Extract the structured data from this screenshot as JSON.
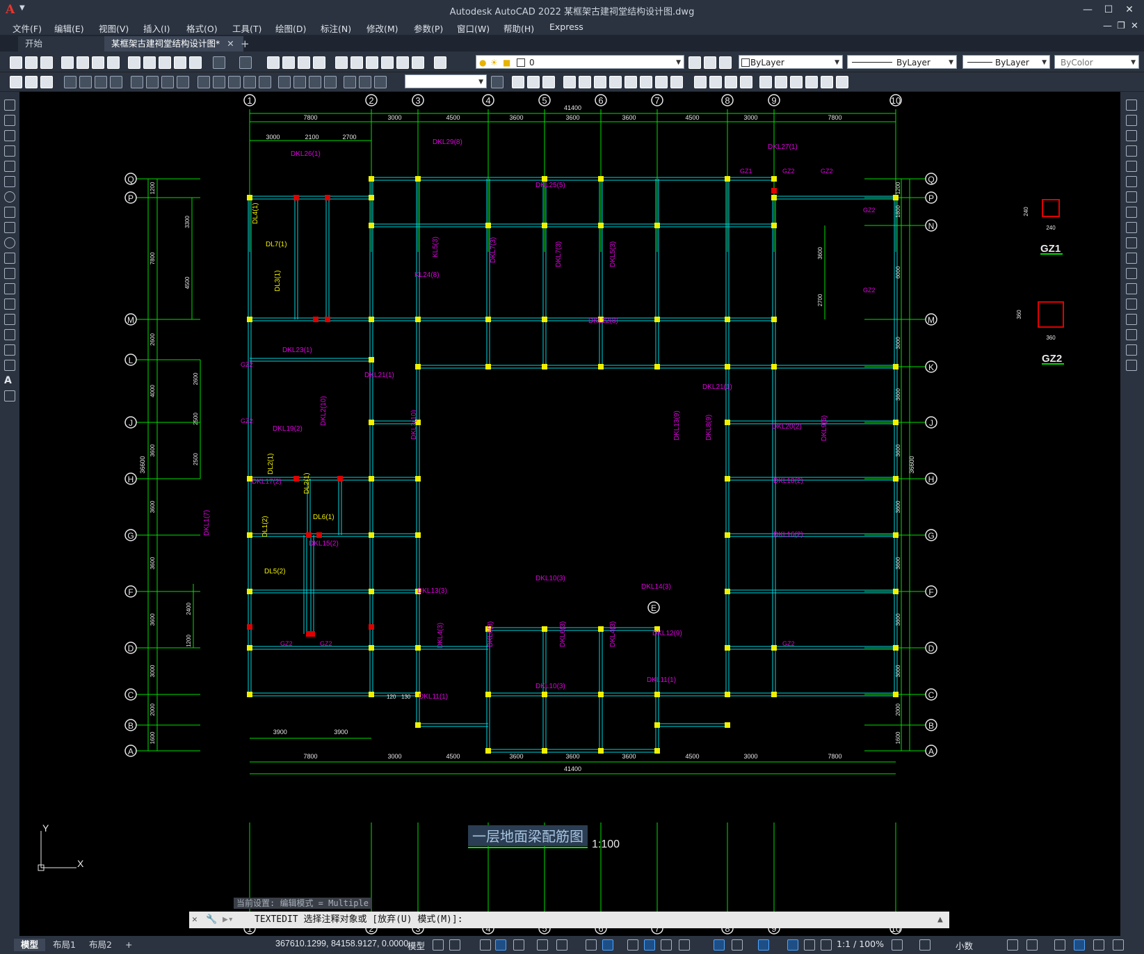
{
  "app": {
    "title": "Autodesk AutoCAD 2022    某框架古建祠堂结构设计图.dwg"
  },
  "menu": [
    "文件(F)",
    "编辑(E)",
    "视图(V)",
    "插入(I)",
    "格式(O)",
    "工具(T)",
    "绘图(D)",
    "标注(N)",
    "修改(M)",
    "参数(P)",
    "窗口(W)",
    "帮助(H)",
    "Express"
  ],
  "tabs": {
    "start": "开始",
    "document": "某框架古建祠堂结构设计图*"
  },
  "toolbar": {
    "layer_value": "0",
    "color_value": "ByLayer",
    "linetype_value": "ByLayer",
    "lineweight_value": "ByLayer",
    "plotstyle_value": "ByColor",
    "textstyle_value": ""
  },
  "drawing": {
    "axes_x": [
      "1",
      "2",
      "3",
      "4",
      "5",
      "6",
      "7",
      "8",
      "9",
      "10"
    ],
    "axes_y": [
      "Q",
      "P",
      "N",
      "M",
      "L",
      "K",
      "J",
      "H",
      "G",
      "F",
      "E",
      "D",
      "C",
      "B",
      "A"
    ],
    "dims_top_total": "41400",
    "dims_top": [
      "7800",
      "3000",
      "4500",
      "3600",
      "3600",
      "3600",
      "4500",
      "3000",
      "7800"
    ],
    "dims_top_sub": [
      "3000",
      "2100",
      "2700"
    ],
    "dims_bottom": [
      "7800",
      "3000",
      "4500",
      "3600",
      "3600",
      "3600",
      "4500",
      "3000",
      "7800"
    ],
    "dims_bottom_sub": [
      "3900",
      "3900"
    ],
    "dims_bottom_total": "41400",
    "dims_left_total": "36600",
    "dims_left": [
      "1200",
      "7800",
      "2600",
      "4000",
      "3600",
      "3600",
      "3600",
      "3600",
      "3000",
      "2000",
      "1600"
    ],
    "dims_left_inner": [
      "3300",
      "4500",
      "2600",
      "2500",
      "2500",
      "2400",
      "1200"
    ],
    "dims_right_total": "36600",
    "dims_right": [
      "1200",
      "1800",
      "6000",
      "3000",
      "3600",
      "3600",
      "3600",
      "3600",
      "3600",
      "3000",
      "2000",
      "1600"
    ],
    "dims_right_inner": [
      "3600",
      "2700"
    ],
    "gz_labels": [
      "GZ2",
      "GZ2",
      "GZ1",
      "GZ2",
      "GZ2",
      "GZ2",
      "GZ2",
      "GZ2",
      "GZ2",
      "GZ2"
    ],
    "beam_labels": [
      "DKL26(1)",
      "DKL29(8)",
      "DKL27(1)",
      "DKL25(5)",
      "DL4(1)",
      "DL7(1)",
      "DL3(1)",
      "KL5(3)",
      "KL24(8)",
      "DKL7(3)",
      "DKL7(3)",
      "DKL5(3)",
      "DKL22(8)",
      "DKL23(1)",
      "DKL21(1)",
      "DKL21(1)",
      "DKL2(10)",
      "DKL3(10)",
      "DKL19(2)",
      "DKL13(9)",
      "DKL8(9)",
      "DKL20(2)",
      "DKL9(6)",
      "DL2(1)",
      "DKL17(2)",
      "DL2(1)",
      "DKL18(2)",
      "DKL1(7)",
      "DL1(2)",
      "DL6(1)",
      "DKL15(2)",
      "DKL16(2)",
      "DL5(2)",
      "DKL10(3)",
      "DKL14(3)",
      "DKL13(3)",
      "DKL4(3)",
      "DKL6(3)",
      "DKL6(3)",
      "DKL4(3)",
      "DKL12(9)",
      "DKL10(3)",
      "DKL11(1)",
      "DKL11(1)"
    ],
    "column_detail_1": {
      "label": "GZ1",
      "dim_a": "240",
      "dim_b": "240"
    },
    "column_detail_2": {
      "label": "GZ2",
      "dim_a": "360",
      "dim_b": "360"
    },
    "drawing_title": "一层地面梁配筋图",
    "scale": "1:100",
    "ucs_x": "X",
    "ucs_y": "Y",
    "small_dims": [
      "120",
      "130"
    ]
  },
  "command": {
    "history": "当前设置: 编辑模式 = Multiple",
    "prompt": "TEXTEDIT 选择注释对象或 [放弃(U) 模式(M)]:"
  },
  "status": {
    "layout_tabs": [
      "模型",
      "布局1",
      "布局2"
    ],
    "coordinates": "367610.1299, 84158.9127, 0.0000",
    "space": "模型",
    "annotation_scale": "1:1 / 100%",
    "units": "小数"
  }
}
